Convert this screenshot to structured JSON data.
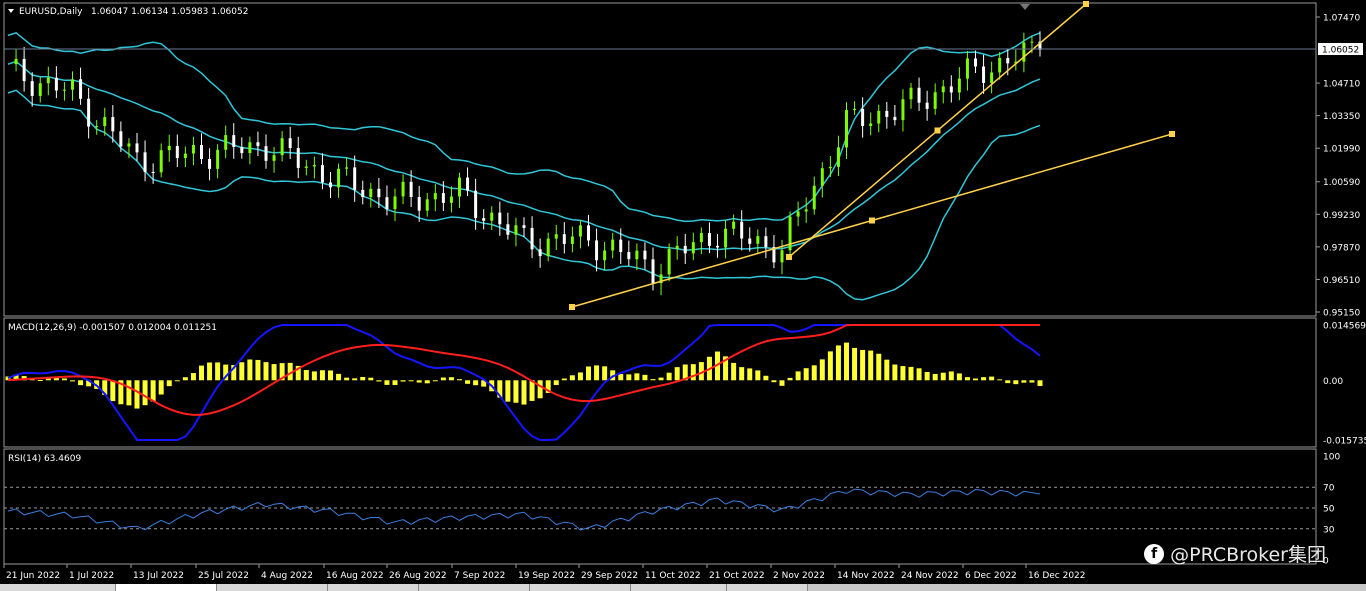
{
  "main_panel": {
    "title": "EURUSD,Daily",
    "ohlc": "1.06047 1.06134 1.05983 1.06052",
    "current_price": "1.06052",
    "y_ticks": [
      "1.07470",
      "1.04710",
      "1.03350",
      "1.01990",
      "1.00590",
      "0.99230",
      "0.97870",
      "0.96510",
      "0.95150"
    ]
  },
  "macd_panel": {
    "title": "MACD(12,26,9) -0.001507 0.012004 0.011251",
    "y_ticks": [
      "0.014569",
      "0.00",
      "-0.015735"
    ]
  },
  "rsi_panel": {
    "title": "RSI(14) 63.4609",
    "y_ticks": [
      "100",
      "70",
      "50",
      "30",
      "0"
    ]
  },
  "x_axis_labels": [
    "21 Jun 2022",
    "1 Jul 2022",
    "13 Jul 2022",
    "25 Jul 2022",
    "4 Aug 2022",
    "16 Aug 2022",
    "26 Aug 2022",
    "7 Sep 2022",
    "19 Sep 2022",
    "29 Sep 2022",
    "11 Oct 2022",
    "21 Oct 2022",
    "2 Nov 2022",
    "14 Nov 2022",
    "24 Nov 2022",
    "6 Dec 2022",
    "16 Dec 2022"
  ],
  "watermark": "@PRCBroker集团",
  "colors": {
    "background": "#000000",
    "bull": "#7CFC00",
    "bear": "#FFFFFF",
    "bands": "#2FC7D8",
    "trendline": "#FFD24A",
    "macd_hist": "#FFFF33",
    "macd_line": "#1515FF",
    "signal_line": "#FF1E1E",
    "rsi": "#3C7FE0"
  },
  "chart_data": [
    {
      "type": "line",
      "title": "EURUSD,Daily",
      "ylim": [
        0.9515,
        1.0747
      ],
      "x": [
        "21 Jun 2022",
        "1 Jul 2022",
        "13 Jul 2022",
        "25 Jul 2022",
        "4 Aug 2022",
        "16 Aug 2022",
        "26 Aug 2022",
        "7 Sep 2022",
        "19 Sep 2022",
        "29 Sep 2022",
        "11 Oct 2022",
        "21 Oct 2022",
        "2 Nov 2022",
        "14 Nov 2022",
        "24 Nov 2022",
        "6 Dec 2022",
        "16 Dec 2022"
      ],
      "series": [
        {
          "values": [
            1.052,
            1.043,
            1.015,
            1.018,
            1.021,
            1.008,
            0.998,
            1.001,
            0.981,
            0.982,
            0.97,
            0.985,
            0.978,
            1.03,
            1.038,
            1.052,
            1.061
          ]
        }
      ],
      "current": 1.06052
    },
    {
      "type": "bar",
      "title": "MACD(12,26,9) -0.001507 0.012004 0.011251",
      "ylim": [
        -0.015735,
        0.014569
      ],
      "series": [
        {
          "values": [
            0.001,
            0.0002,
            -0.008,
            0.004,
            0.0052,
            0.002,
            -0.001,
            0.0006,
            -0.007,
            0.004,
            0.0005,
            0.007,
            -0.001,
            0.01,
            0.003,
            0.001,
            -0.0015
          ]
        }
      ]
    },
    {
      "type": "line",
      "title": "RSI(14) 63.4609",
      "ylim": [
        0,
        100
      ],
      "series": [
        {
          "values": [
            47,
            43,
            30,
            45,
            54,
            47,
            36,
            41,
            44,
            30,
            47,
            58,
            48,
            67,
            63,
            66,
            63.46
          ]
        }
      ]
    }
  ]
}
